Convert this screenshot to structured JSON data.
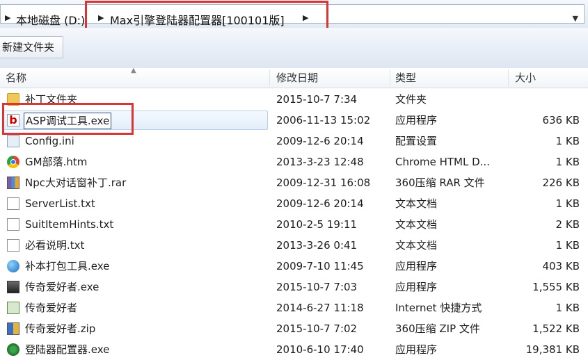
{
  "address": {
    "crumbs": [
      "本地磁盘 (D:)",
      "Max引擎登陆器配置器[100101版]"
    ]
  },
  "toolbar": {
    "new_folder_label": "新建文件夹"
  },
  "columns": {
    "name": "名称",
    "date": "修改日期",
    "type": "类型",
    "size": "大小"
  },
  "files": [
    {
      "name": "补丁文件夹",
      "date": "2015-10-7 7:34",
      "type": "文件夹",
      "size": "",
      "icon": "folder-icon"
    },
    {
      "name": "ASP调试工具.exe",
      "date": "2006-11-13 15:02",
      "type": "应用程序",
      "size": "636 KB",
      "icon": "app-b-icon"
    },
    {
      "name": "Config.ini",
      "date": "2009-12-6 20:14",
      "type": "配置设置",
      "size": "1 KB",
      "icon": "ini-file-icon"
    },
    {
      "name": "GM部落.htm",
      "date": "2013-3-23 12:48",
      "type": "Chrome HTML D...",
      "size": "1 KB",
      "icon": "chrome-icon"
    },
    {
      "name": "Npc大对话窗补丁.rar",
      "date": "2009-12-31 16:08",
      "type": "360压缩 RAR 文件",
      "size": "226 KB",
      "icon": "rar-archive-icon"
    },
    {
      "name": "ServerList.txt",
      "date": "2009-12-6 20:14",
      "type": "文本文档",
      "size": "1 KB",
      "icon": "text-file-icon"
    },
    {
      "name": "SuitItemHints.txt",
      "date": "2010-2-5 19:11",
      "type": "文本文档",
      "size": "2 KB",
      "icon": "text-file-icon"
    },
    {
      "name": "必看说明.txt",
      "date": "2013-3-26 0:41",
      "type": "文本文档",
      "size": "1 KB",
      "icon": "text-file-icon"
    },
    {
      "name": "补本打包工具.exe",
      "date": "2009-7-10 11:45",
      "type": "应用程序",
      "size": "403 KB",
      "icon": "globe-app-icon"
    },
    {
      "name": "传奇爱好者.exe",
      "date": "2015-10-7 7:03",
      "type": "应用程序",
      "size": "1,555 KB",
      "icon": "exe-app-icon"
    },
    {
      "name": "传奇爱好者",
      "date": "2014-6-27 11:18",
      "type": "Internet 快捷方式",
      "size": "1 KB",
      "icon": "shortcut-icon"
    },
    {
      "name": "传奇爱好者.zip",
      "date": "2015-10-7 7:02",
      "type": "360压缩 ZIP 文件",
      "size": "1,522 KB",
      "icon": "zip-archive-icon"
    },
    {
      "name": "登陆器配置器.exe",
      "date": "2010-6-10 17:40",
      "type": "应用程序",
      "size": "19,381 KB",
      "icon": "config-app-icon"
    }
  ]
}
